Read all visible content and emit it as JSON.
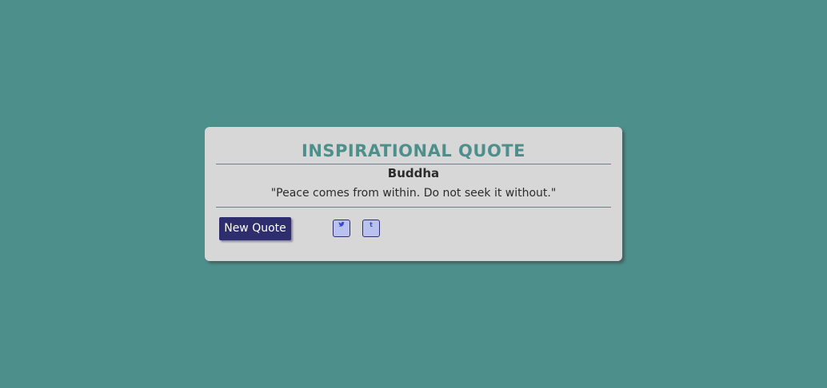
{
  "card": {
    "title": "INSPIRATIONAL QUOTE",
    "author": "Buddha",
    "quote": "\"Peace comes from within. Do not seek it without.\""
  },
  "actions": {
    "new_quote_label": "New Quote",
    "twitter_icon": "twitter-icon",
    "tumblr_icon": "tumblr-icon",
    "twitter_glyph": "𝕥",
    "tumblr_glyph": "t"
  },
  "colors": {
    "background": "#4d8f8b",
    "card": "#d8d7d8",
    "accent": "#4d8f8b",
    "button": "#2e2e6e",
    "share_button": "#b9c1ee"
  }
}
